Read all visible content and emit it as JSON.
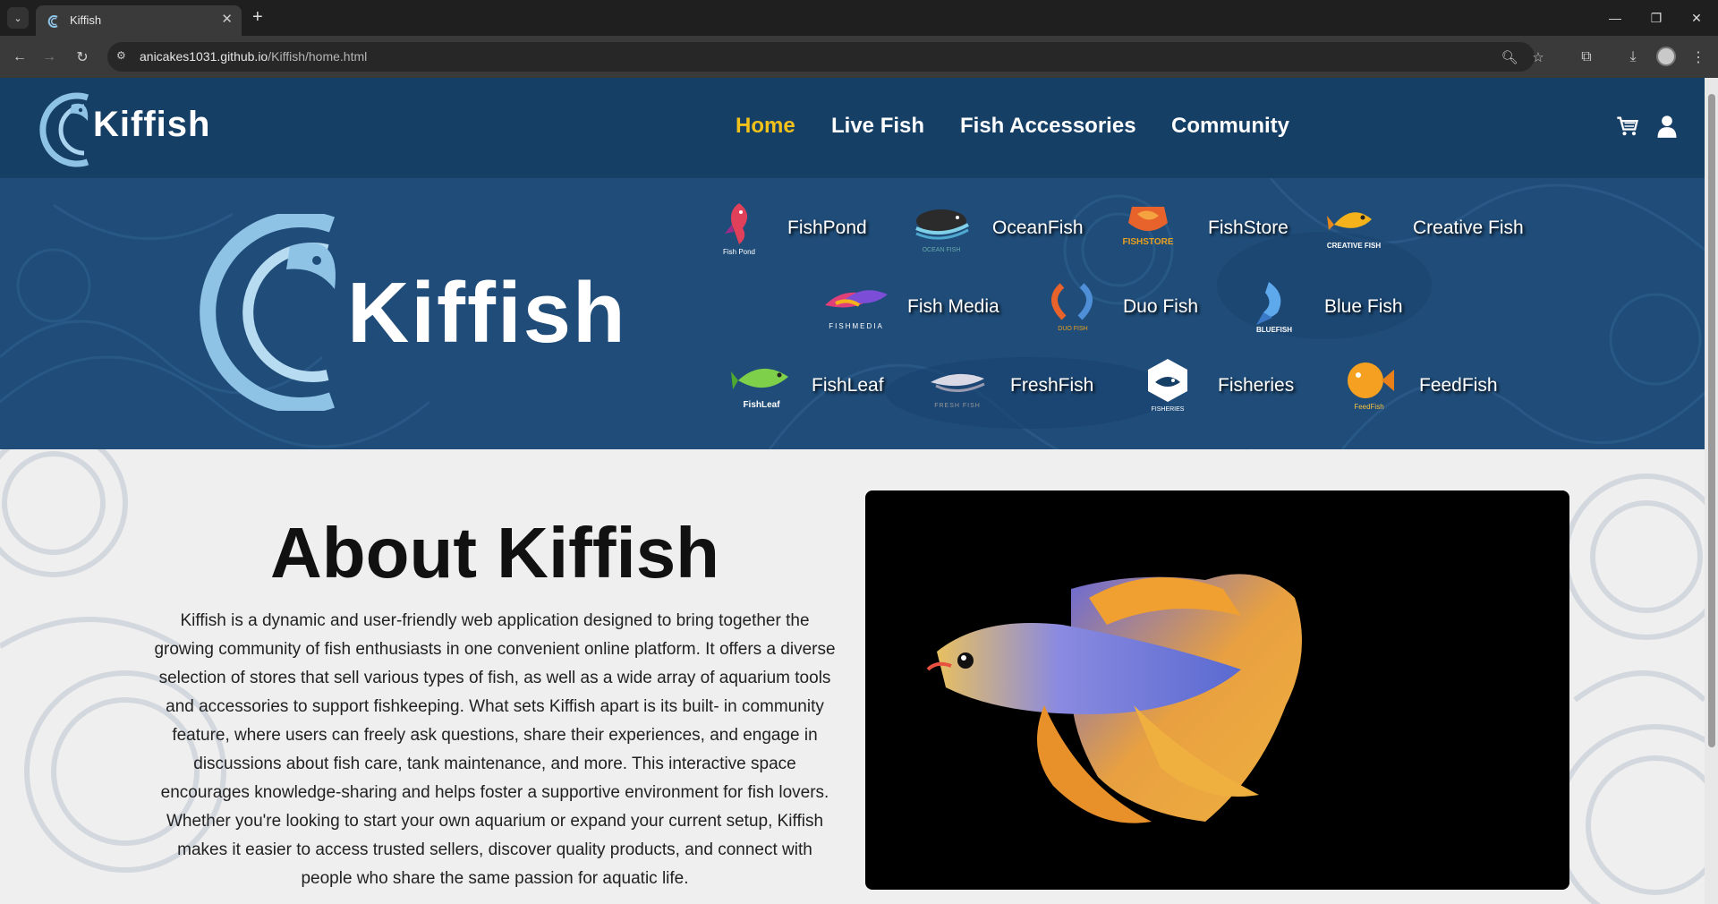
{
  "browser": {
    "tab_title": "Kiffish",
    "url_host": "anicakes1031.github.io",
    "url_path": "/Kiffish/home.html"
  },
  "header": {
    "logo_text": "Kiffish",
    "nav": [
      {
        "label": "Home",
        "active": true
      },
      {
        "label": "Live Fish",
        "active": false
      },
      {
        "label": "Fish Accessories",
        "active": false
      },
      {
        "label": "Community",
        "active": false
      }
    ],
    "icons": [
      "cart-icon",
      "user-icon"
    ]
  },
  "hero": {
    "logo_text": "Kiffish",
    "stores": [
      {
        "name": "FishPond",
        "logo_caption": "Fish Pond"
      },
      {
        "name": "OceanFish",
        "logo_caption": "OCEAN FISH"
      },
      {
        "name": "FishStore",
        "logo_caption": "FISHSTORE"
      },
      {
        "name": "Creative Fish",
        "logo_caption": "CREATIVE FISH"
      },
      {
        "name": "Fish Media",
        "logo_caption": "FISHMEDIA"
      },
      {
        "name": "Duo Fish",
        "logo_caption": "DUO FISH"
      },
      {
        "name": "Blue Fish",
        "logo_caption": "BLUEFISH"
      },
      {
        "name": "FishLeaf",
        "logo_caption": "FishLeaf"
      },
      {
        "name": "FreshFish",
        "logo_caption": "FRESH FISH"
      },
      {
        "name": "Fisheries",
        "logo_caption": "FISHERIES"
      },
      {
        "name": "FeedFish",
        "logo_caption": "FeedFish"
      }
    ]
  },
  "about": {
    "title": "About Kiffish",
    "body": "Kiffish is a dynamic and user-friendly web application designed to bring together the growing community of fish enthusiasts in one convenient online platform. It offers a diverse selection of stores that sell various types of fish, as well as a wide array of aquarium tools and accessories to support fishkeeping. What sets Kiffish apart is its built- in community feature, where users can freely ask questions, share their experiences, and engage in discussions about fish care, tank maintenance, and more. This interactive space encourages knowledge-sharing and helps foster a supportive environment for fish lovers. Whether you're looking to start your own aquarium or expand your current setup, Kiffish makes it easier to access trusted sellers, discover quality products, and connect with people who share the same passion for aquatic life."
  },
  "colors": {
    "header_bg": "#163f66",
    "hero_bg": "#1f4c78",
    "nav_active": "#f2c21b"
  }
}
